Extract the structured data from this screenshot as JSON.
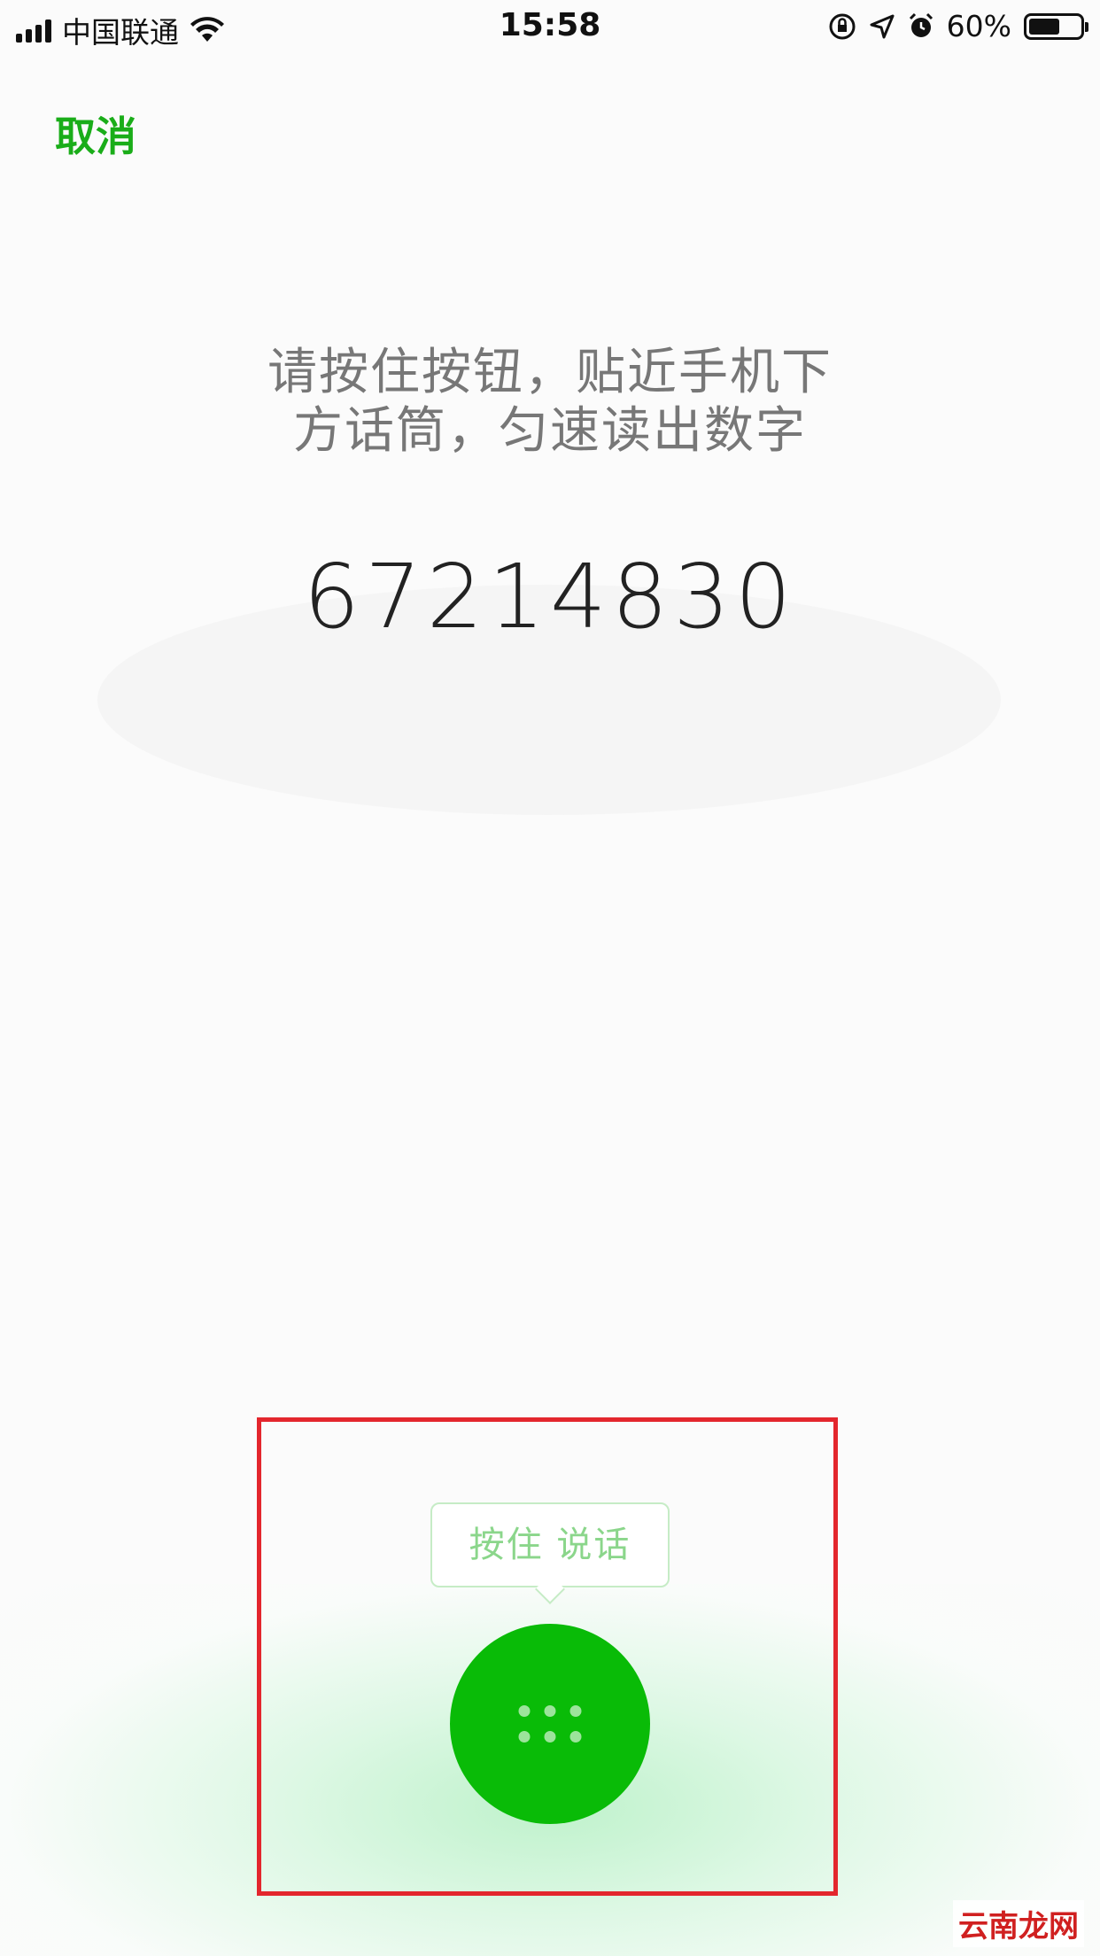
{
  "status_bar": {
    "carrier": "中国联通",
    "time": "15:58",
    "battery_percent": "60%",
    "battery_level": 0.6
  },
  "header": {
    "cancel_label": "取消"
  },
  "main": {
    "instruction_line1": "请按住按钮，贴近手机下",
    "instruction_line2": "方话筒，匀速读出数字",
    "digits": "67214830"
  },
  "record": {
    "tooltip_label": "按住 说话",
    "button_icon": "keypad-dots-icon"
  },
  "watermark": {
    "text": "云南龙网"
  },
  "colors": {
    "accent_green": "#1aad19",
    "button_green": "#09bb07",
    "highlight_red": "#e3262d"
  }
}
